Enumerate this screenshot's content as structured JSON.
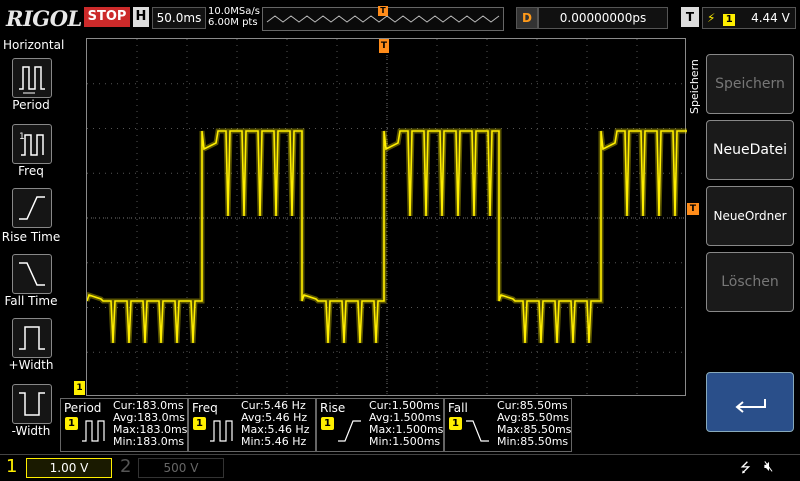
{
  "brand": "RIGOL",
  "run_state": "STOP",
  "timebase": {
    "label": "H",
    "value": "50.0ms"
  },
  "sample": {
    "rate": "10.0MSa/s",
    "points": "6.00M pts"
  },
  "delay": {
    "label": "D",
    "value": "0.00000000ps"
  },
  "trigger": {
    "label": "T",
    "channel": "1",
    "level": "4.44 V"
  },
  "horizontal_menu": {
    "title": "Horizontal",
    "items": [
      {
        "label": "Period"
      },
      {
        "label": "Freq"
      },
      {
        "label": "Rise Time"
      },
      {
        "label": "Fall Time"
      },
      {
        "label": "+Width"
      },
      {
        "label": "-Width"
      }
    ]
  },
  "right_menu": {
    "title": "Speichern",
    "items": [
      {
        "label": "Speichern",
        "enabled": false
      },
      {
        "label": "NeueDatei",
        "enabled": true
      },
      {
        "label": "NeueOrdner",
        "enabled": true
      },
      {
        "label": "Löschen",
        "enabled": false
      }
    ]
  },
  "measurements": [
    {
      "name": "Period",
      "channel": "1",
      "cur": "Cur:183.0ms",
      "avg": "Avg:183.0ms",
      "max": "Max:183.0ms",
      "min": "Min:183.0ms"
    },
    {
      "name": "Freq",
      "channel": "1",
      "cur": "Cur:5.46 Hz",
      "avg": "Avg:5.46 Hz",
      "max": "Max:5.46 Hz",
      "min": "Min:5.46 Hz"
    },
    {
      "name": "Rise",
      "channel": "1",
      "cur": "Cur:1.500ms",
      "avg": "Avg:1.500ms",
      "max": "Max:1.500ms",
      "min": "Min:1.500ms"
    },
    {
      "name": "Fall",
      "channel": "1",
      "cur": "Cur:85.50ms",
      "avg": "Avg:85.50ms",
      "max": "Max:85.50ms",
      "min": "Min:85.50ms"
    }
  ],
  "channels": [
    {
      "number": "1",
      "scale": "1.00 V",
      "color": "#ffef00"
    },
    {
      "number": "2",
      "scale": "500 V",
      "color": "#5a5a5a"
    }
  ],
  "markers": {
    "trigger": "T",
    "ground": "1"
  },
  "colors": {
    "trace": "#ffef00",
    "trigger_marker": "#ff8c1a",
    "stop": "#cc2a2a"
  }
}
